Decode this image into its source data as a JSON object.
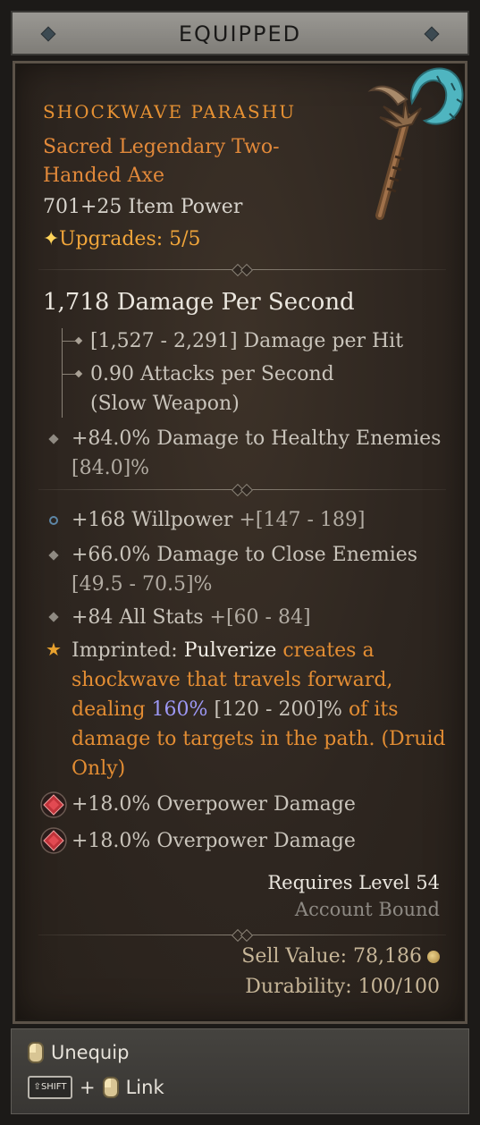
{
  "header": {
    "title": "EQUIPPED"
  },
  "item": {
    "name": "SHOCKWAVE PARASHU",
    "type": "Sacred Legendary Two-Handed Axe",
    "item_power": "701+25 Item Power",
    "upgrades": "Upgrades: 5/5",
    "image_icon": "axe-icon"
  },
  "weapon_stats": {
    "dps": "1,718 Damage Per Second",
    "damage_per_hit": "[1,527 - 2,291] Damage per Hit",
    "attacks_per_second": "0.90 Attacks per Second (Slow Weapon)",
    "implicit": "+84.0% Damage to Healthy Enemies",
    "implicit_range": "[84.0]%"
  },
  "affixes": {
    "willpower": "+168 Willpower",
    "willpower_range": "+[147 - 189]",
    "close_enemies": "+66.0% Damage to Close Enemies",
    "close_enemies_range": "[49.5 - 70.5]%",
    "all_stats": "+84 All Stats",
    "all_stats_range": "+[60 - 84]"
  },
  "imprint": {
    "label": "Imprinted:",
    "skill": "Pulverize",
    "text1": "creates a shockwave that travels forward, dealing",
    "value": "160%",
    "range": "[120 - 200]%",
    "text2": "of its damage to targets in the path. (Druid Only)"
  },
  "sockets": [
    {
      "text": "+18.0% Overpower Damage"
    },
    {
      "text": "+18.0% Overpower Damage"
    }
  ],
  "requirements": {
    "level": "Requires Level 54",
    "bound": "Account Bound"
  },
  "value": {
    "sell": "Sell Value: 78,186",
    "durability": "Durability: 100/100"
  },
  "footer": {
    "unequip": "Unequip",
    "shift_key": "SHIFT",
    "plus": "+",
    "link": "Link"
  },
  "colors": {
    "legendary": "#e2893a",
    "imprint_value": "#9d98f5"
  }
}
